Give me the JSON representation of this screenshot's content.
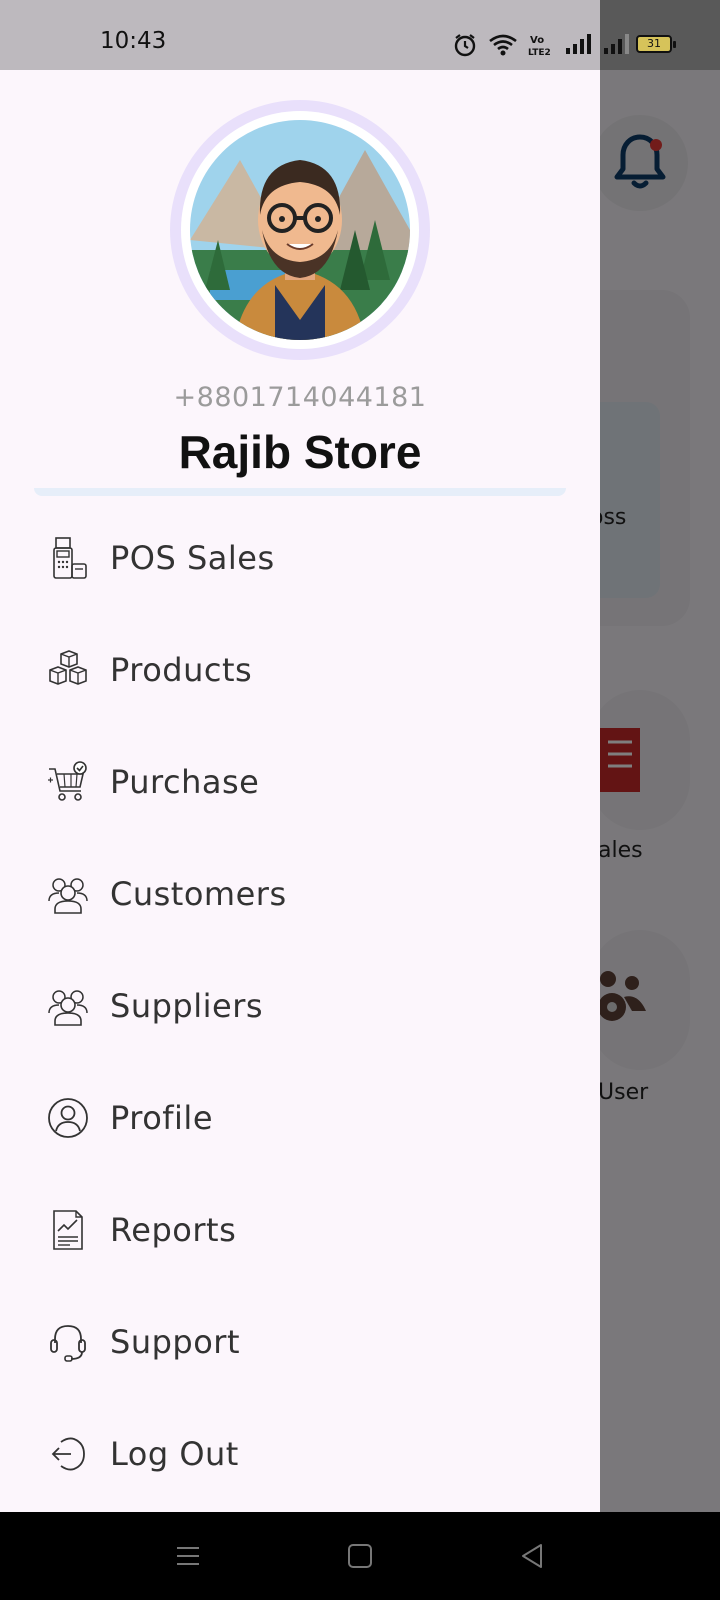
{
  "status_bar": {
    "time": "10:43",
    "battery": "31",
    "icons": [
      "alarm-icon",
      "wifi-icon",
      "volte-icon",
      "signal-icon",
      "signal-icon",
      "battery-icon"
    ]
  },
  "drawer": {
    "phone": "+8801714044181",
    "store_name": "Rajib Store",
    "menu": [
      {
        "label": "POS Sales",
        "icon": "pos-terminal-icon"
      },
      {
        "label": "Products",
        "icon": "boxes-icon"
      },
      {
        "label": "Purchase",
        "icon": "cart-icon"
      },
      {
        "label": "Customers",
        "icon": "customers-icon"
      },
      {
        "label": "Suppliers",
        "icon": "suppliers-icon"
      },
      {
        "label": "Profile",
        "icon": "profile-icon"
      },
      {
        "label": "Reports",
        "icon": "report-icon"
      },
      {
        "label": "Support",
        "icon": "headset-icon"
      },
      {
        "label": "Log Out",
        "icon": "logout-icon"
      }
    ]
  },
  "background": {
    "card_text": "oss",
    "sales_text": "ales",
    "user_text": "User"
  },
  "colors": {
    "drawer_bg": "#fcf6fc",
    "accent_ring": "#e9e0fb",
    "bell": "#0d3b66",
    "bell_dot": "#e53935"
  }
}
